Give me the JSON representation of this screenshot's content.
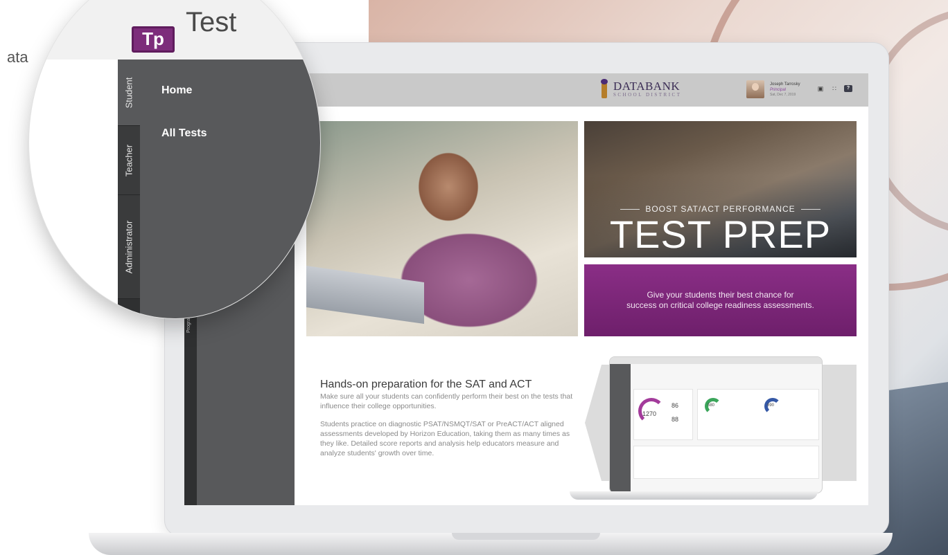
{
  "background_text": "ata",
  "app": {
    "logo_letters": "Tp",
    "app_name": "Test",
    "district_name": "DATABANK",
    "district_sub": "SCHOOL DISTRICT"
  },
  "user": {
    "name": "Joseph Tarrosky",
    "role": "Principal",
    "date": "Sat, Dec 7, 2019"
  },
  "role_tabs": [
    {
      "label": "Student"
    },
    {
      "label": "Teacher"
    },
    {
      "label": "Administrator"
    }
  ],
  "nav": {
    "items": [
      {
        "label": "Home"
      },
      {
        "label": "All Tests"
      }
    ],
    "program_manager": "Program Manager"
  },
  "hero": {
    "promo_small": "BOOST SAT/ACT PERFORMANCE",
    "promo_big": "TEST PREP",
    "promo_line1": "Give your students their best chance for",
    "promo_line2": "success on critical college readiness assessments."
  },
  "info": {
    "heading": "Hands-on preparation for the SAT and ACT",
    "para1": "Make sure all your students can confidently perform their best on the tests that influence their college opportunities.",
    "para2": "Students practice on diagnostic PSAT/NSMQT/SAT or PreACT/ACT aligned assessments developed by Horizon Education, taking them as many times as they like. Detailed score reports and analysis help educators measure and analyze students' growth over time."
  },
  "mini_preview": {
    "score_total": "1270",
    "score_a": "86",
    "score_b": "88",
    "score_c": "580",
    "score_d": "690"
  },
  "colors": {
    "brand_purple": "#7d2d7b",
    "sidebar_gray": "#58595b",
    "topbar_gray": "#c9c9c9"
  }
}
